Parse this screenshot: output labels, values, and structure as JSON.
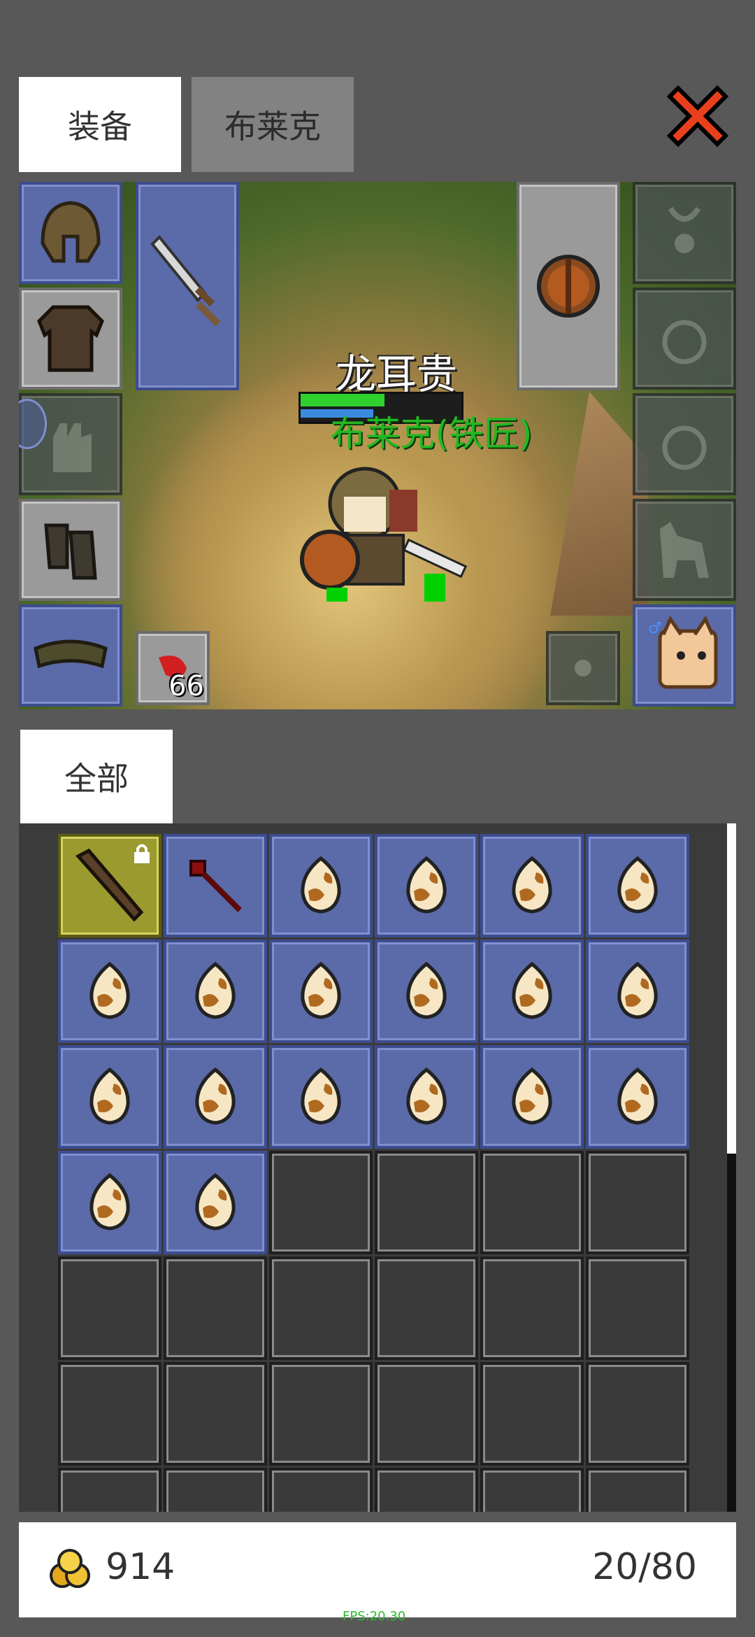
{
  "tabs": {
    "equipment": "装备",
    "character": "布莱克"
  },
  "scene": {
    "player_name": "龙耳贵",
    "npc_label": "布莱克(铁匠)",
    "hp_fraction": 0.52,
    "mp_fraction": 0.45
  },
  "equipment_slots": {
    "consumable_qty": "66"
  },
  "filter": {
    "label": "全部"
  },
  "inventory": {
    "items": [
      "wooden-club-icon",
      "red-staff-icon",
      "egg-icon",
      "egg-icon",
      "egg-icon",
      "egg-icon",
      "egg-icon",
      "egg-icon",
      "egg-icon",
      "egg-icon",
      "egg-icon",
      "egg-icon",
      "egg-icon",
      "egg-icon",
      "egg-icon",
      "egg-icon",
      "egg-icon",
      "egg-icon",
      "egg-icon",
      "egg-icon",
      "",
      "",
      "",
      "",
      "",
      "",
      "",
      "",
      "",
      "",
      "",
      "",
      "",
      "",
      "",
      "",
      "",
      "",
      "",
      "",
      "",
      ""
    ],
    "scroll_fraction": 0.48
  },
  "footer": {
    "gold": "914",
    "capacity": "20/80"
  },
  "debug": {
    "fps": "FPS:20.30"
  },
  "colors": {
    "slot_blue": "#5b6aa8",
    "slot_gray": "#9a9a9a",
    "close_red": "#e8401c",
    "npc_green": "#22b822"
  }
}
